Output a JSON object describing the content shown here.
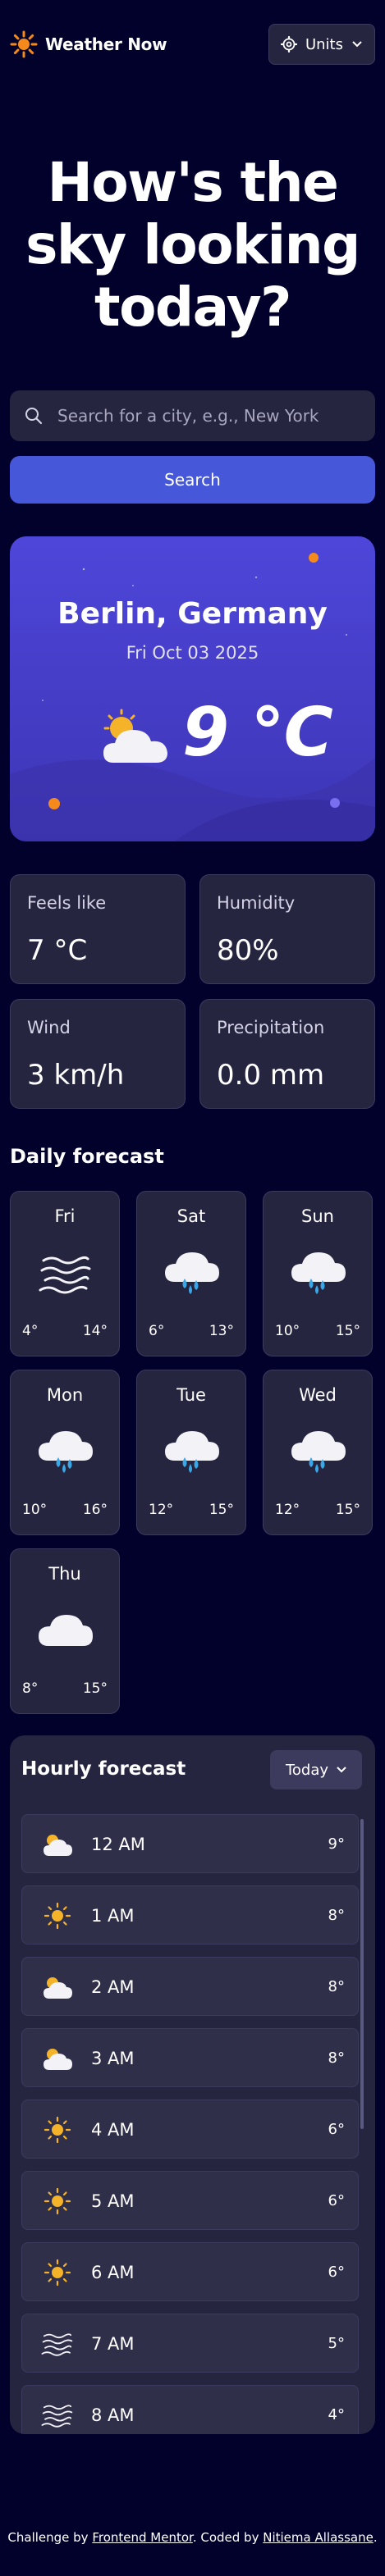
{
  "header": {
    "app_name": "Weather Now",
    "units_label": "Units"
  },
  "hero": {
    "line1": "How's the",
    "line2": "sky looking",
    "line3": "today?"
  },
  "search": {
    "placeholder": "Search for a city, e.g., New York",
    "button_label": "Search"
  },
  "current": {
    "city": "Berlin, Germany",
    "date": "Fri Oct 03 2025",
    "temperature": "9 °C",
    "condition_icon": "partly-cloudy-icon"
  },
  "stats": [
    {
      "label": "Feels like",
      "value": "7 °C"
    },
    {
      "label": "Humidity",
      "value": "80%"
    },
    {
      "label": "Wind",
      "value": "3 km/h"
    },
    {
      "label": "Precipitation",
      "value": "0.0 mm"
    }
  ],
  "daily": {
    "title": "Daily forecast",
    "days": [
      {
        "day": "Fri",
        "low": "4°",
        "high": "14°",
        "icon": "fog-icon"
      },
      {
        "day": "Sat",
        "low": "6°",
        "high": "13°",
        "icon": "rain-icon"
      },
      {
        "day": "Sun",
        "low": "10°",
        "high": "15°",
        "icon": "rain-icon"
      },
      {
        "day": "Mon",
        "low": "10°",
        "high": "16°",
        "icon": "rain-icon"
      },
      {
        "day": "Tue",
        "low": "12°",
        "high": "15°",
        "icon": "rain-icon"
      },
      {
        "day": "Wed",
        "low": "12°",
        "high": "15°",
        "icon": "rain-icon"
      },
      {
        "day": "Thu",
        "low": "8°",
        "high": "15°",
        "icon": "cloud-icon"
      }
    ]
  },
  "hourly": {
    "title": "Hourly forecast",
    "selected_day": "Today",
    "hours": [
      {
        "time": "12 AM",
        "temp": "9°",
        "icon": "partly-cloudy-icon"
      },
      {
        "time": "1 AM",
        "temp": "8°",
        "icon": "sun-icon"
      },
      {
        "time": "2 AM",
        "temp": "8°",
        "icon": "partly-cloudy-icon"
      },
      {
        "time": "3 AM",
        "temp": "8°",
        "icon": "partly-cloudy-icon"
      },
      {
        "time": "4 AM",
        "temp": "6°",
        "icon": "sun-icon"
      },
      {
        "time": "5 AM",
        "temp": "6°",
        "icon": "sun-icon"
      },
      {
        "time": "6 AM",
        "temp": "6°",
        "icon": "sun-icon"
      },
      {
        "time": "7 AM",
        "temp": "5°",
        "icon": "fog-icon"
      },
      {
        "time": "8 AM",
        "temp": "4°",
        "icon": "fog-icon"
      }
    ]
  },
  "footer": {
    "prefix": "Challenge by ",
    "link1": "Frontend Mentor",
    "middle": ". Coded by ",
    "link2": "Nitiema Allassane",
    "suffix": "."
  },
  "colors": {
    "background": "#02012b",
    "card": "#262540",
    "accent": "#4658d9",
    "sun": "#f4b328"
  }
}
